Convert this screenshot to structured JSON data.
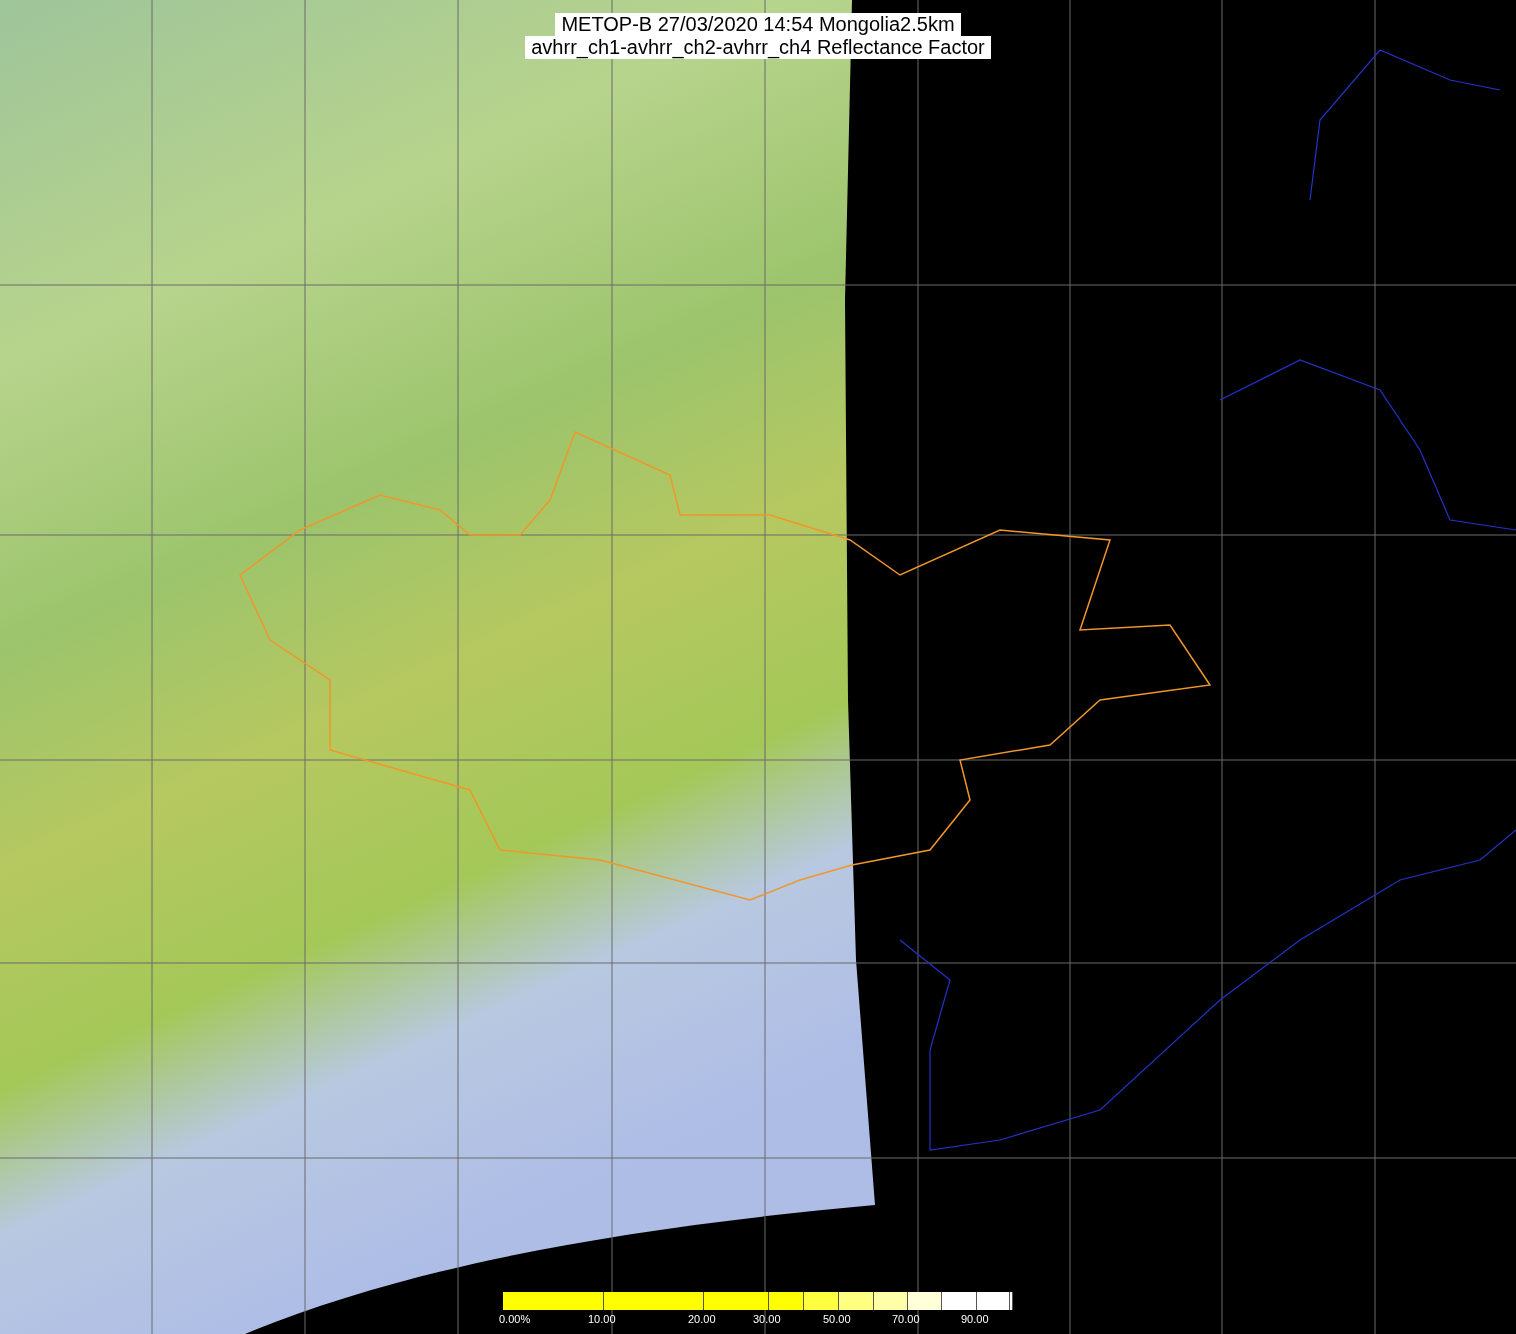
{
  "title": {
    "lines": [
      "METOP-B 27/03/2020 14:54 Mongolia2.5km",
      "avhrr_ch1-avhrr_ch2-avhrr_ch4 Reflectance Factor"
    ]
  },
  "colorbar": {
    "segments": [
      {
        "color": "#ffff00",
        "label": "0.00%"
      },
      {
        "color": "#ffff00",
        "label": "10.00"
      },
      {
        "color": "#ffff00",
        "label": "20.00"
      },
      {
        "color": "#ffff00",
        "label": "30.00"
      },
      {
        "color": "#ffff40"
      },
      {
        "color": "#ffff80",
        "label": "50.00"
      },
      {
        "color": "#ffffa8"
      },
      {
        "color": "#ffffd8",
        "label": "70.00"
      },
      {
        "color": "#ffffff"
      },
      {
        "color": "#ffffff",
        "label": "90.00"
      },
      {
        "color": "#ffffff"
      }
    ]
  }
}
